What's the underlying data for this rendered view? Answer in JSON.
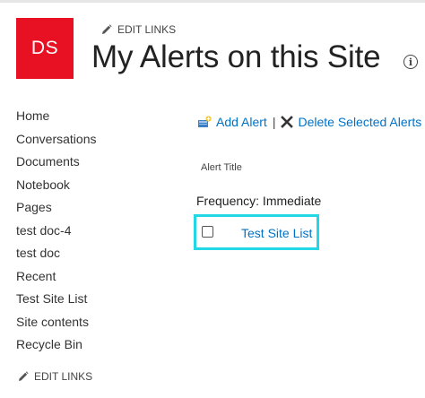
{
  "site": {
    "logo_text": "DS",
    "edit_links_label": "EDIT LINKS",
    "title": "My Alerts on this Site",
    "brand_color": "#e81123"
  },
  "quicklaunch": {
    "items": [
      "Home",
      "Conversations",
      "Documents",
      "Notebook",
      "Pages",
      "test doc-4",
      "test doc",
      "Recent",
      "Test Site List",
      "Site contents",
      "Recycle Bin"
    ],
    "edit_links_label": "EDIT LINKS"
  },
  "toolbar": {
    "add_alert_label": "Add Alert",
    "separator": "|",
    "delete_label": "Delete Selected Alerts",
    "link_color": "#0072c6"
  },
  "alerts": {
    "column_header": "Alert Title",
    "frequency_label": "Frequency: Immediate",
    "items": [
      {
        "title": "Test Site List",
        "checked": false
      }
    ],
    "highlight_color": "#22d8e6"
  },
  "icons": {
    "pencil": "pencil-icon",
    "info": "info-icon",
    "add_alert": "add-alert-icon",
    "delete": "delete-x-icon"
  }
}
